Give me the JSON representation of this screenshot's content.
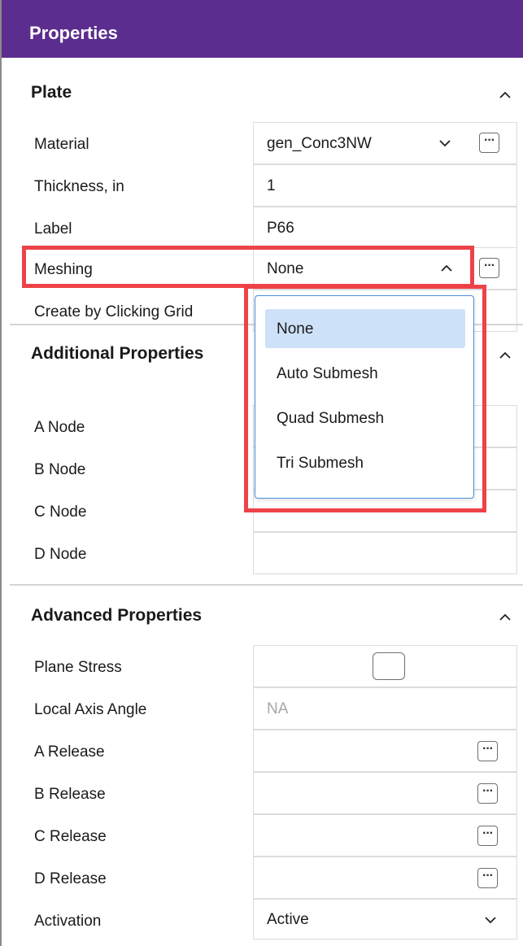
{
  "panel": {
    "title": "Properties"
  },
  "plate": {
    "header": "Plate",
    "rows": {
      "material": {
        "label": "Material",
        "value": "gen_Conc3NW"
      },
      "thickness": {
        "label": "Thickness, in",
        "value": "1"
      },
      "label": {
        "label": "Label",
        "value": "P66"
      },
      "meshing": {
        "label": "Meshing",
        "value": "None"
      },
      "create_by_grid": {
        "label": "Create by Clicking Grid"
      }
    }
  },
  "additional": {
    "header": "Additional Properties",
    "rows": {
      "a_node": {
        "label": "A Node"
      },
      "b_node": {
        "label": "B Node"
      },
      "c_node": {
        "label": "C Node"
      },
      "d_node": {
        "label": "D Node"
      }
    }
  },
  "advanced": {
    "header": "Advanced Properties",
    "rows": {
      "plane_stress": {
        "label": "Plane Stress",
        "checked": false
      },
      "local_axis_angle": {
        "label": "Local Axis Angle",
        "value": "NA"
      },
      "a_release": {
        "label": "A Release"
      },
      "b_release": {
        "label": "B Release"
      },
      "c_release": {
        "label": "C Release"
      },
      "d_release": {
        "label": "D Release"
      },
      "activation": {
        "label": "Activation",
        "value": "Active"
      }
    }
  },
  "meshing_dropdown": {
    "options": [
      "None",
      "Auto Submesh",
      "Quad Submesh",
      "Tri Submesh"
    ],
    "selected": "None"
  },
  "colors": {
    "titlebar": "#5b2d8e",
    "highlight": "#ee4249",
    "dropdown_border": "#4a90d9",
    "selected_option": "#cde2f8"
  }
}
